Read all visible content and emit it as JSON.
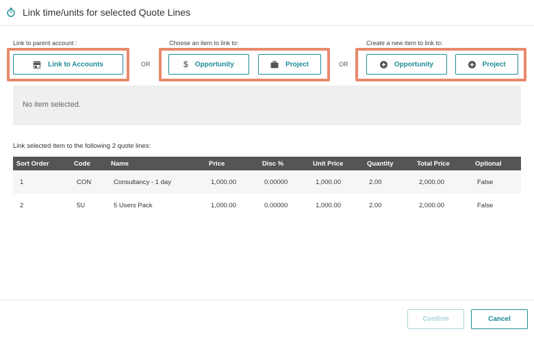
{
  "dialog": {
    "title": "Link time/units for selected Quote Lines",
    "title_icon": "stopwatch-icon"
  },
  "groups": {
    "parent": {
      "label": "Link to parent account :",
      "button": {
        "label": "Link to Accounts",
        "icon": "store-icon"
      }
    },
    "choose": {
      "label": "Choose an item to link to:",
      "opportunity": {
        "label": "Opportunity",
        "icon": "dollar-icon"
      },
      "project": {
        "label": "Project",
        "icon": "briefcase-icon"
      }
    },
    "create": {
      "label": "Create a new item to link to:",
      "opportunity": {
        "label": "Opportunity",
        "icon": "plus-circle-icon"
      },
      "project": {
        "label": "Project",
        "icon": "plus-circle-icon"
      }
    },
    "or_1": "OR",
    "or_2": "OR"
  },
  "selection": {
    "empty_text": "No item selected."
  },
  "quote_lines": {
    "caption": "Link selected item to the following 2 quote lines:",
    "columns": [
      "Sort Order",
      "Code",
      "Name",
      "Price",
      "Disc %",
      "Unit Price",
      "Quantity",
      "Total Price",
      "Optional"
    ],
    "rows": [
      [
        "1",
        "CON",
        "Consultancy - 1 day",
        "1,000.00",
        "0.00000",
        "1,000.00",
        "2.00",
        "2,000.00",
        "False"
      ],
      [
        "2",
        "5U",
        "5 Users Pack",
        "1,000.00",
        "0.00000",
        "1,000.00",
        "2.00",
        "2,000.00",
        "False"
      ]
    ]
  },
  "footer": {
    "confirm_label": "Confirm",
    "cancel_label": "Cancel"
  },
  "colors": {
    "accent": "#1d8a96",
    "highlight": "#e8896b",
    "table_header": "#555555"
  }
}
